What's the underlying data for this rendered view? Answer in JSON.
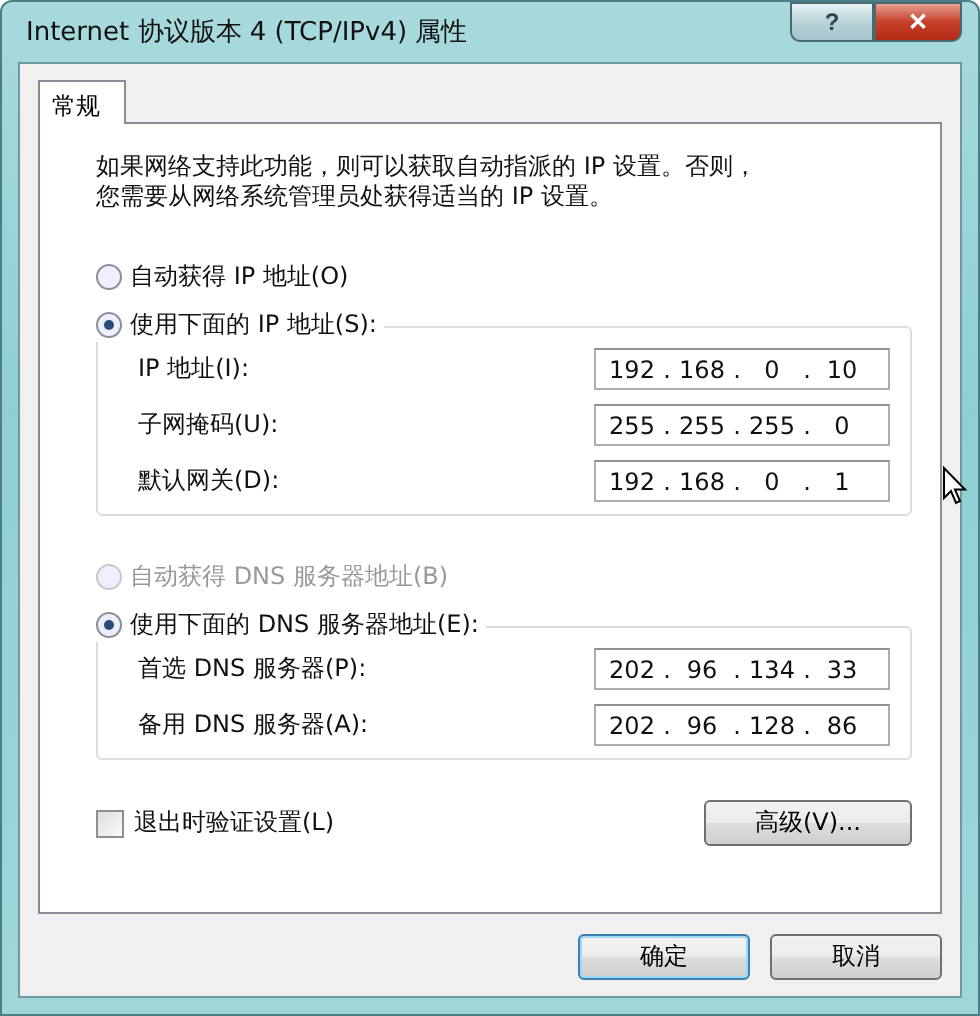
{
  "window": {
    "title": "Internet 协议版本 4 (TCP/IPv4) 属性",
    "help": "?",
    "close": "✕"
  },
  "tabs": [
    {
      "label": "常规",
      "selected": true
    }
  ],
  "intro": [
    "如果网络支持此功能，则可以获取自动指派的 IP 设置。否则，",
    "您需要从网络系统管理员处获得适当的 IP 设置。"
  ],
  "ip_section": {
    "auto": {
      "label": "自动获得 IP 地址(O)",
      "selected": false,
      "disabled": false
    },
    "manual": {
      "label": "使用下面的 IP 地址(S):",
      "selected": true,
      "disabled": false
    },
    "fields": [
      {
        "label": "IP 地址(I):",
        "octets": [
          "192",
          "168",
          "0",
          "10"
        ]
      },
      {
        "label": "子网掩码(U):",
        "octets": [
          "255",
          "255",
          "255",
          "0"
        ]
      },
      {
        "label": "默认网关(D):",
        "octets": [
          "192",
          "168",
          "0",
          "1"
        ]
      }
    ]
  },
  "dns_section": {
    "auto": {
      "label": "自动获得 DNS 服务器地址(B)",
      "selected": false,
      "disabled": true
    },
    "manual": {
      "label": "使用下面的 DNS 服务器地址(E):",
      "selected": true,
      "disabled": false
    },
    "fields": [
      {
        "label": "首选 DNS 服务器(P):",
        "octets": [
          "202",
          "96",
          "134",
          "33"
        ]
      },
      {
        "label": "备用 DNS 服务器(A):",
        "octets": [
          "202",
          "96",
          "128",
          "86"
        ]
      }
    ]
  },
  "octet_separator": ".",
  "validate": {
    "label": "退出时验证设置(L)",
    "checked": false
  },
  "advanced_button": "高级(V)...",
  "buttons": [
    "确定",
    "取消"
  ]
}
